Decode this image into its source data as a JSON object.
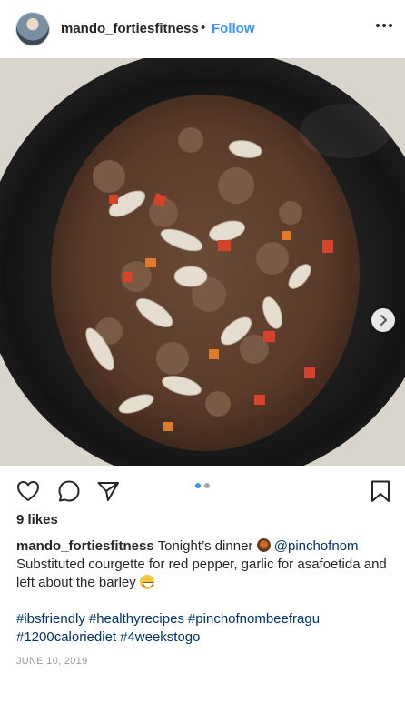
{
  "header": {
    "username": "mando_fortiesfitness",
    "separator": "•",
    "follow_label": "Follow",
    "avatar_icon": "profile-avatar",
    "more_icon": "more-options-icon"
  },
  "media": {
    "description_icon": "slow-cooker-stew-photo",
    "next_icon": "chevron-right-icon",
    "carousel_count": 2,
    "carousel_active_index": 0
  },
  "actions": {
    "like_icon": "heart-icon",
    "comment_icon": "comment-icon",
    "share_icon": "share-icon",
    "save_icon": "bookmark-icon"
  },
  "likes": "9 likes",
  "caption": {
    "username": "mando_fortiesfitness",
    "text_before_emoji": "Tonight’s dinner",
    "mention": "@pinchofnom",
    "line2": "Substituted courgette for red pepper, garlic for asafoetida and left about the barley",
    "emoji_1": "bowl-emoji",
    "emoji_2": "grinning-emoji"
  },
  "hashtags": [
    "#ibsfriendly",
    "#healthyrecipes",
    "#pinchofnombeefragu",
    "#1200caloriediet",
    "#4weekstogo"
  ],
  "date": "JUNE 10, 2019",
  "colors": {
    "link_blue": "#3897f0",
    "hashtag_blue": "#003569",
    "text": "#262626",
    "muted": "#999999",
    "dot_active": "#3897f0",
    "dot_inactive": "#a8a8a8"
  }
}
